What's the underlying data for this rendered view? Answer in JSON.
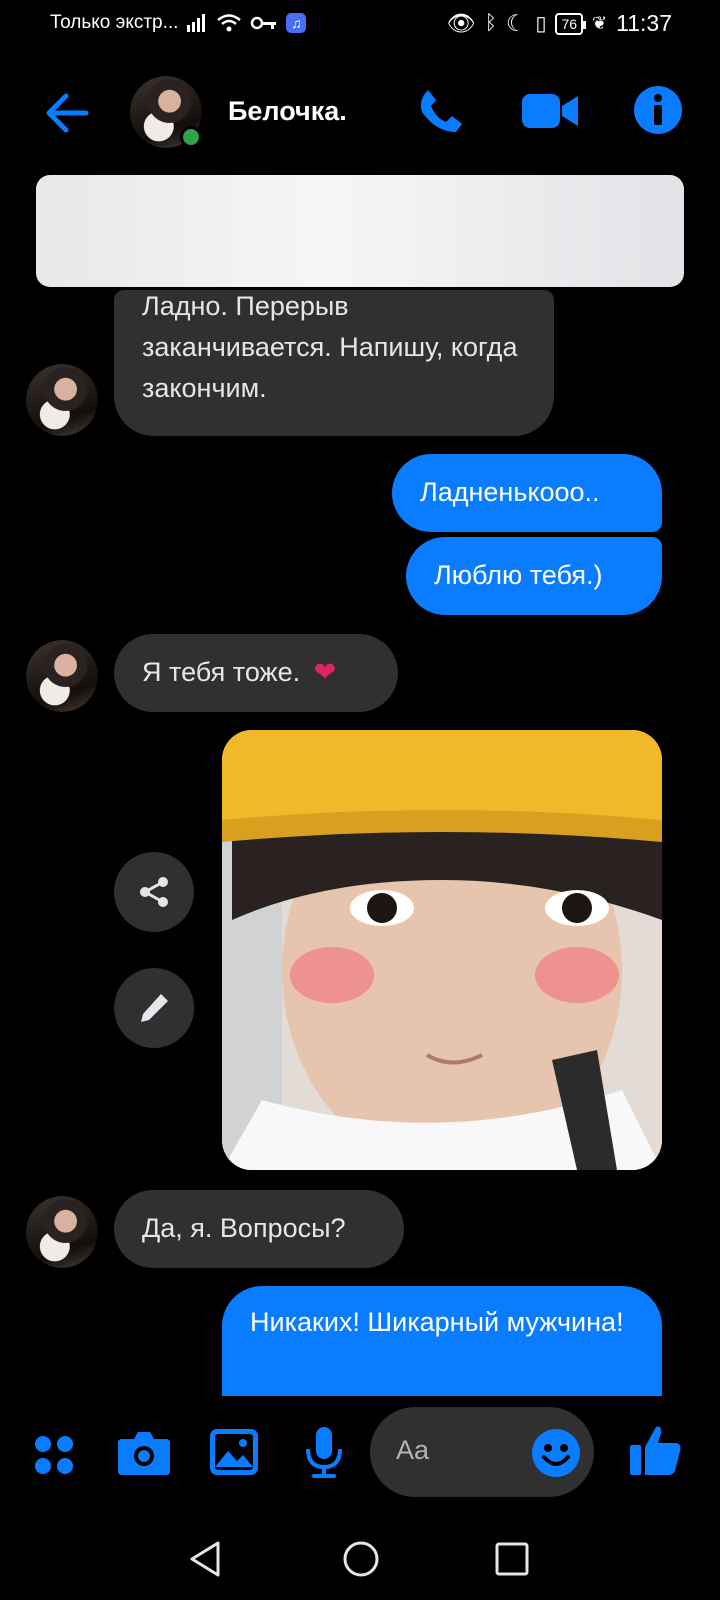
{
  "status_bar": {
    "carrier_text": "Только экстр...",
    "time": "11:37",
    "battery": "76"
  },
  "header": {
    "contact_name": "Белочка."
  },
  "messages": [
    {
      "direction": "in",
      "text": "Ладно. Перерыв заканчивается. Напишу, когда закончим."
    },
    {
      "direction": "out",
      "text": "Ладненькооо.."
    },
    {
      "direction": "out",
      "text": "Люблю тебя.)"
    },
    {
      "direction": "in",
      "text": "Я тебя тоже."
    },
    {
      "direction": "in",
      "text": "Да, я. Вопросы?"
    },
    {
      "direction": "out",
      "text": "Никаких! Шикарный мужчина!"
    }
  ],
  "composer": {
    "placeholder": "Aa"
  },
  "colors": {
    "accent": "#0a7cff",
    "incoming_bubble": "#303030",
    "online": "#31a24c",
    "background": "#000000"
  },
  "icons": [
    "back-arrow-icon",
    "phone-icon",
    "video-camera-icon",
    "info-icon",
    "share-icon",
    "pencil-icon",
    "apps-grid-icon",
    "camera-icon",
    "gallery-icon",
    "microphone-icon",
    "emoji-icon",
    "thumbs-up-icon",
    "heart-emoji",
    "nav-back-icon",
    "nav-home-icon",
    "nav-recents-icon"
  ]
}
